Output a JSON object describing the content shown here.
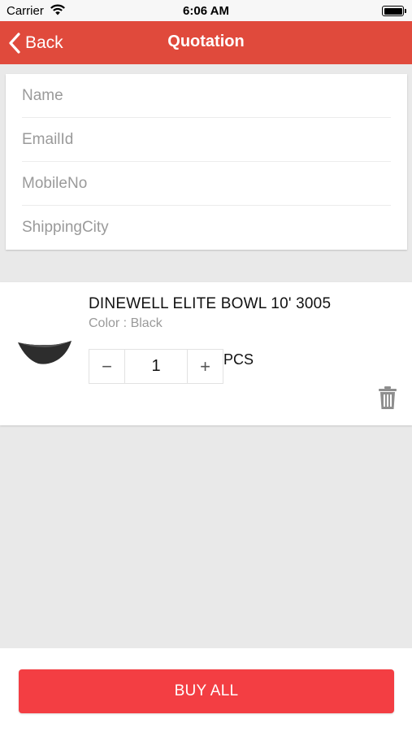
{
  "status_bar": {
    "carrier": "Carrier",
    "time": "6:06 AM",
    "icons": [
      "wifi-icon",
      "battery-icon"
    ]
  },
  "nav": {
    "back_label": "Back",
    "back_icon": "chevron-left-icon",
    "title": "Quotation",
    "background_color": "#e04a3c"
  },
  "form": {
    "fields": [
      {
        "placeholder": "Name",
        "value": ""
      },
      {
        "placeholder": "EmailId",
        "value": ""
      },
      {
        "placeholder": "MobileNo",
        "value": ""
      },
      {
        "placeholder": "ShippingCity",
        "value": ""
      }
    ]
  },
  "cart": {
    "items": [
      {
        "name": "DINEWELL ELITE BOWL 10' 3005",
        "color_text": "Color : Black",
        "image_icon": "bowl-image",
        "quantity": "1",
        "decrement_symbol": "−",
        "increment_symbol": "+",
        "unit": "PCS",
        "delete_icon": "trash-icon"
      }
    ]
  },
  "footer": {
    "buy_all_label": "BUY ALL",
    "button_color": "#f33e43"
  }
}
